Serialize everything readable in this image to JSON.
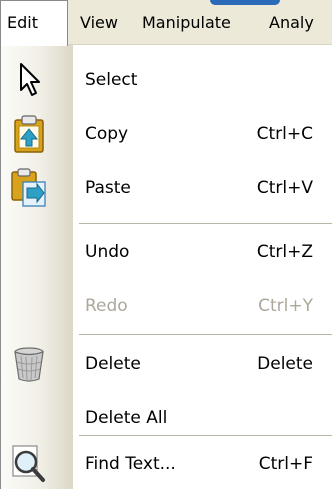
{
  "menubar": {
    "items": [
      {
        "label": "Edit"
      },
      {
        "label": "View"
      },
      {
        "label": "Manipulate"
      },
      {
        "label": "Analy"
      }
    ]
  },
  "edit_menu": {
    "items": [
      {
        "label": "Select",
        "shortcut": "",
        "icon": "arrow-pointer-icon",
        "enabled": true
      },
      {
        "label": "Copy",
        "shortcut": "Ctrl+C",
        "icon": "copy-clipboard-icon",
        "enabled": true
      },
      {
        "label": "Paste",
        "shortcut": "Ctrl+V",
        "icon": "paste-clipboard-icon",
        "enabled": true
      },
      {
        "label": "Undo",
        "shortcut": "Ctrl+Z",
        "icon": "",
        "enabled": true
      },
      {
        "label": "Redo",
        "shortcut": "Ctrl+Y",
        "icon": "",
        "enabled": false
      },
      {
        "label": "Delete",
        "shortcut": "Delete",
        "icon": "trash-bin-icon",
        "enabled": true
      },
      {
        "label": "Delete All",
        "shortcut": "",
        "icon": "",
        "enabled": true
      },
      {
        "label": "Find Text...",
        "shortcut": "Ctrl+F",
        "icon": "magnifier-icon",
        "enabled": true
      }
    ]
  },
  "colors": {
    "menubar_bg": "#ece9d8",
    "disabled_text": "#aca899",
    "separator": "#b9b6a8"
  }
}
